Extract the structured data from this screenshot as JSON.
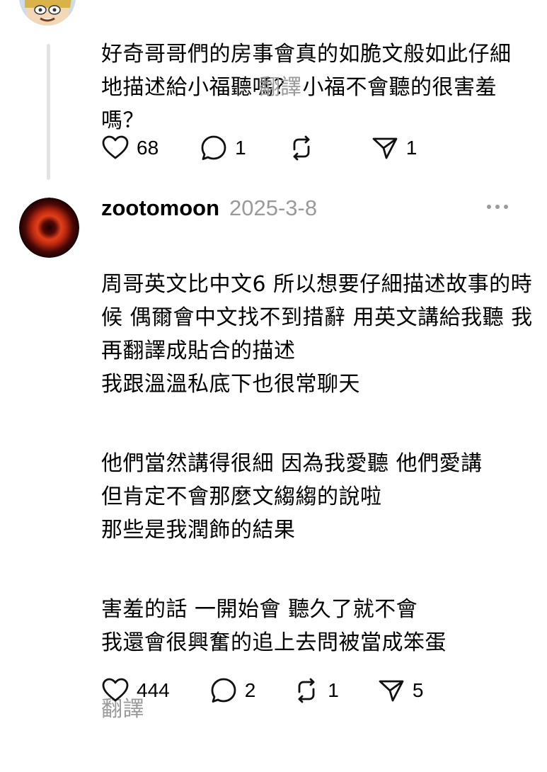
{
  "post1": {
    "lines": [
      "好奇哥哥們的房事會真的如脆文般如此仔細地描述給小福聽嗎？ 小福不會聽的很害羞嗎？"
    ],
    "translate": "翻譯",
    "likes": "68",
    "comments": "1",
    "shares": "1"
  },
  "post2": {
    "author": "zootomoon",
    "date": "2025-3-8",
    "paragraphs": [
      "周哥英文比中文6 所以想要仔細描述故事的時候 偶爾會中文找不到措辭 用英文講給我聽 我再翻譯成貼合的描述\n我跟溫溫私底下也很常聊天",
      "他們當然講得很細 因為我愛聽 他們愛講\n但肯定不會那麼文縐縐的說啦\n那些是我潤飾的結果",
      "害羞的話 一開始會 聽久了就不會\n我還會很興奮的追上去問被當成笨蛋"
    ],
    "translate": "翻譯",
    "likes": "444",
    "comments": "2",
    "reposts": "1",
    "shares": "5"
  }
}
